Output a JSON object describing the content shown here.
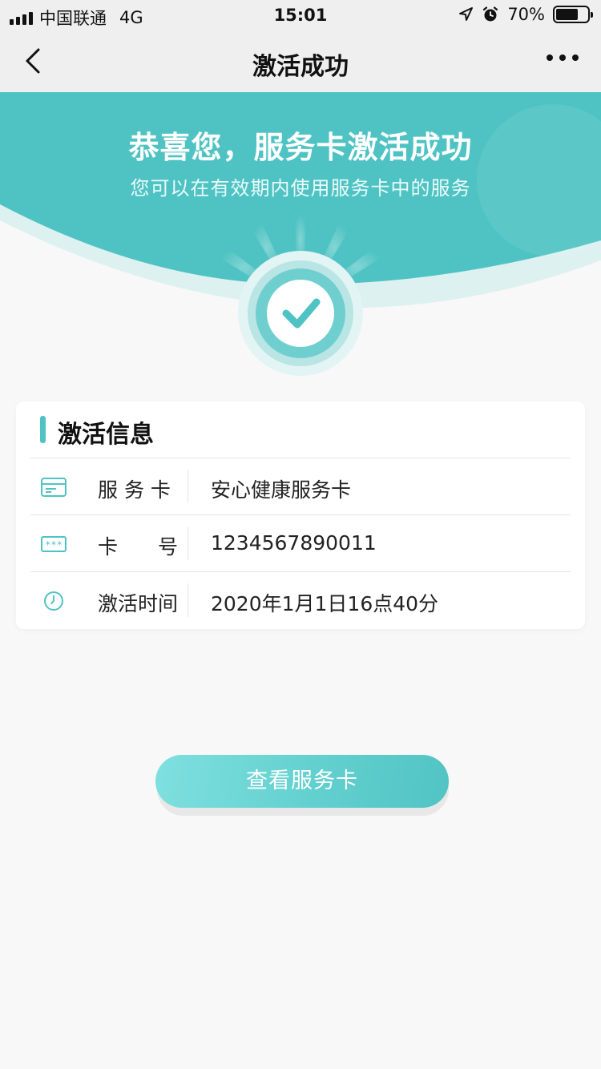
{
  "status_bar": {
    "carrier": "中国联通",
    "network": "4G",
    "time": "15:01",
    "battery_percent": "70%",
    "battery_level": 0.7,
    "icons": [
      "signal-icon",
      "location-icon",
      "alarm-icon",
      "battery-icon"
    ]
  },
  "nav": {
    "title": "激活成功",
    "back_icon": "chevron-left-icon",
    "more_icon": "more-horizontal-icon"
  },
  "hero": {
    "title": "恭喜您，服务卡激活成功",
    "subtitle": "您可以在有效期内使用服务卡中的服务",
    "icon": "check-circle-icon"
  },
  "info_card": {
    "title": "激活信息",
    "rows": [
      {
        "icon": "card-icon",
        "label": "服 务 卡",
        "value": "安心健康服务卡"
      },
      {
        "icon": "card-number-icon",
        "label": "卡　　号",
        "value": "1234567890011"
      },
      {
        "icon": "clock-icon",
        "label": "激活时间",
        "value": "2020年1月1日16点40分"
      }
    ]
  },
  "button": {
    "label": "查看服务卡"
  },
  "colors": {
    "accent": "#4fc3c3",
    "accent_light": "#7fe0df",
    "background": "#f8f8f8",
    "nav_background": "#efefef"
  }
}
